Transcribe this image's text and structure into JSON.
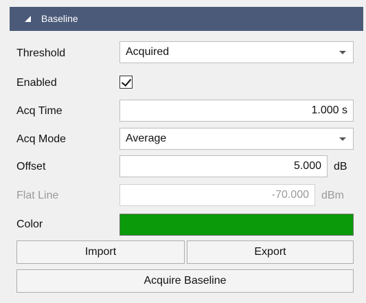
{
  "header": {
    "title": "Baseline",
    "icon": "collapse-triangle-icon"
  },
  "threshold": {
    "label": "Threshold",
    "value": "Acquired"
  },
  "enabled": {
    "label": "Enabled",
    "checked": true
  },
  "acq_time": {
    "label": "Acq Time",
    "value": "1.000 s"
  },
  "acq_mode": {
    "label": "Acq Mode",
    "value": "Average"
  },
  "offset": {
    "label": "Offset",
    "value": "5.000",
    "unit": "dB"
  },
  "flat_line": {
    "label": "Flat Line",
    "value": "-70.000",
    "unit": "dBm",
    "disabled": true
  },
  "color": {
    "label": "Color",
    "value": "#0a9a0a"
  },
  "buttons": {
    "import": "Import",
    "export": "Export",
    "acquire": "Acquire Baseline"
  }
}
